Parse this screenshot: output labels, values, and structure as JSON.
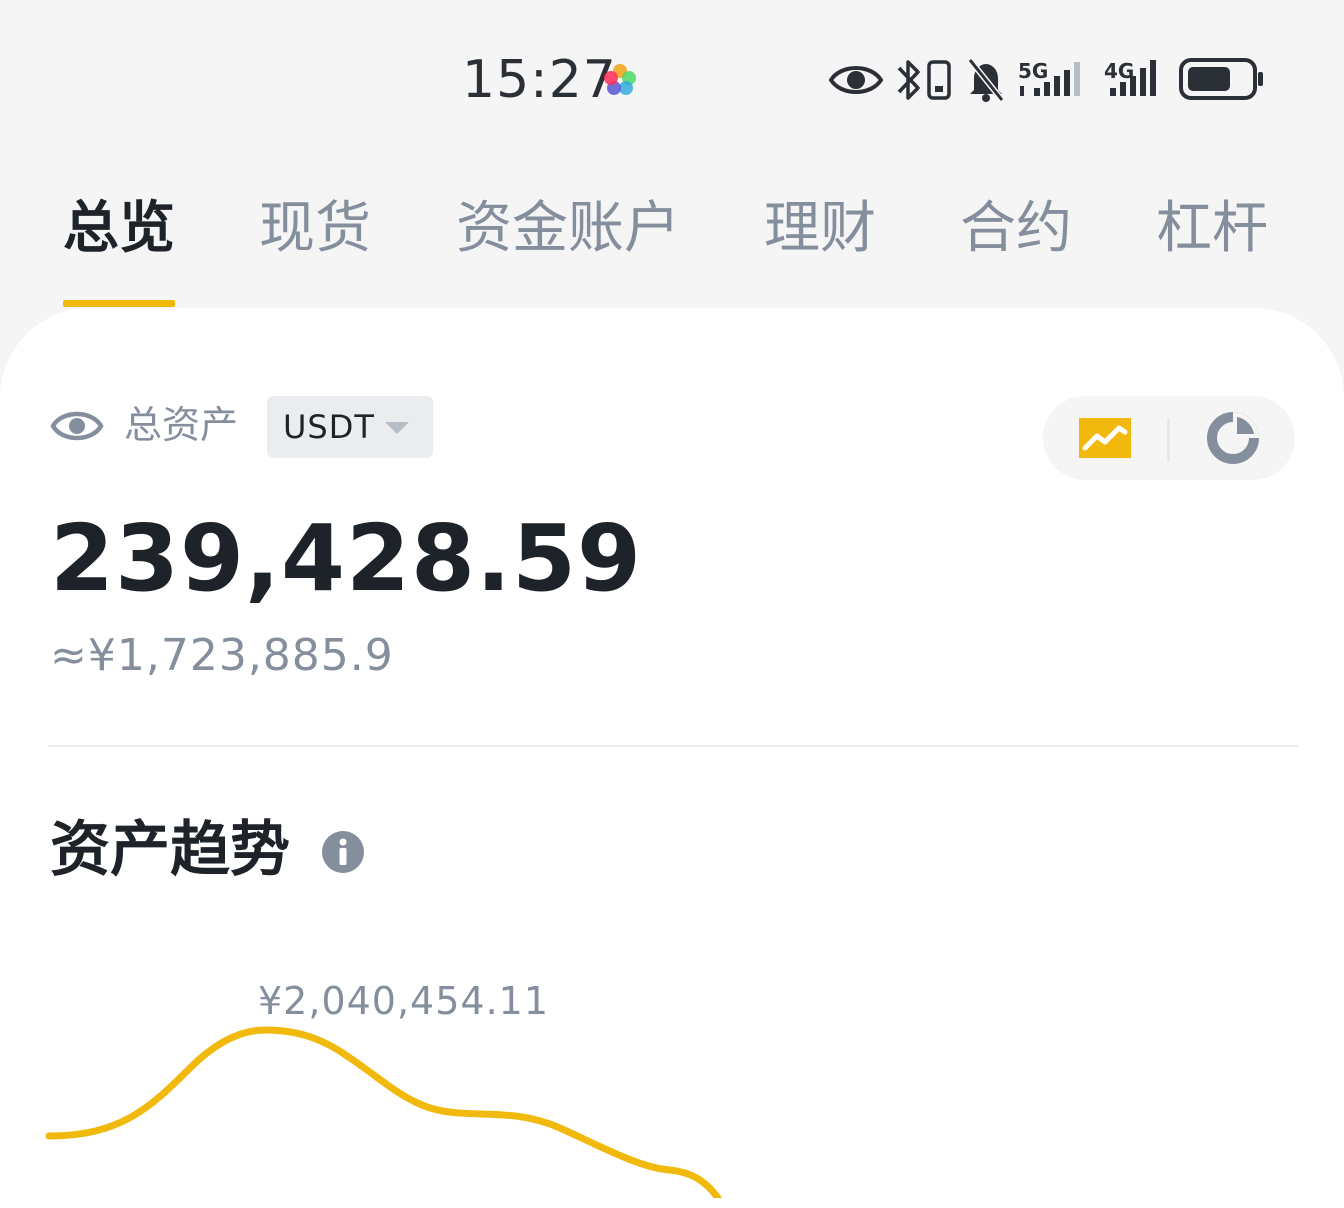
{
  "status_bar": {
    "time": "15:27",
    "network_1": "5G",
    "network_2": "4G"
  },
  "tabs": [
    {
      "label": "总览",
      "active": true
    },
    {
      "label": "现货",
      "active": false
    },
    {
      "label": "资金账户",
      "active": false
    },
    {
      "label": "理财",
      "active": false
    },
    {
      "label": "合约",
      "active": false
    },
    {
      "label": "杠杆",
      "active": false
    }
  ],
  "overview": {
    "total_label": "总资产",
    "currency": "USDT",
    "total_value": "239,428.59",
    "cny_value": "≈¥1,723,885.9"
  },
  "trend": {
    "title": "资产趋势",
    "peak_label": "¥2,040,454.11"
  },
  "colors": {
    "accent": "#f0b90b",
    "text_primary": "#1e2329",
    "text_secondary": "#848e9c",
    "page_bg": "#f5f5f5",
    "card_bg": "#ffffff"
  },
  "icons": {
    "status": [
      "eye-icon",
      "bluetooth-icon",
      "phone-icon",
      "bell-muted-icon",
      "signal-icon",
      "battery-icon"
    ],
    "view_switch": [
      "line-chart-icon",
      "pie-chart-icon"
    ],
    "trend_info": "info-icon",
    "visibility": "eye-icon"
  }
}
